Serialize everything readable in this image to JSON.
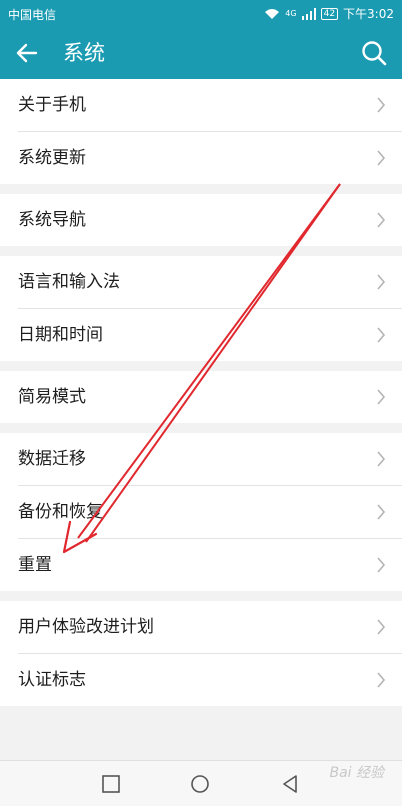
{
  "status_bar": {
    "carrier": "中国电信",
    "network": "4G",
    "battery": "42",
    "time": "下午3:02"
  },
  "app_bar": {
    "title": "系统",
    "back_icon": "arrow-left-icon",
    "search_icon": "search-icon"
  },
  "groups": [
    {
      "items": [
        {
          "label": "关于手机"
        },
        {
          "label": "系统更新"
        }
      ]
    },
    {
      "items": [
        {
          "label": "系统导航"
        }
      ]
    },
    {
      "items": [
        {
          "label": "语言和输入法"
        },
        {
          "label": "日期和时间"
        }
      ]
    },
    {
      "items": [
        {
          "label": "简易模式"
        }
      ]
    },
    {
      "items": [
        {
          "label": "数据迁移"
        },
        {
          "label": "备份和恢复"
        },
        {
          "label": "重置"
        }
      ]
    },
    {
      "items": [
        {
          "label": "用户体验改进计划"
        },
        {
          "label": "认证标志"
        }
      ]
    }
  ],
  "nav_bar": {
    "recent_icon": "square-icon",
    "home_icon": "circle-icon",
    "back_icon": "triangle-back-icon"
  },
  "colors": {
    "accent": "#1a9bb1",
    "annotation": "#e0282e"
  },
  "watermark": "Bai 经验"
}
